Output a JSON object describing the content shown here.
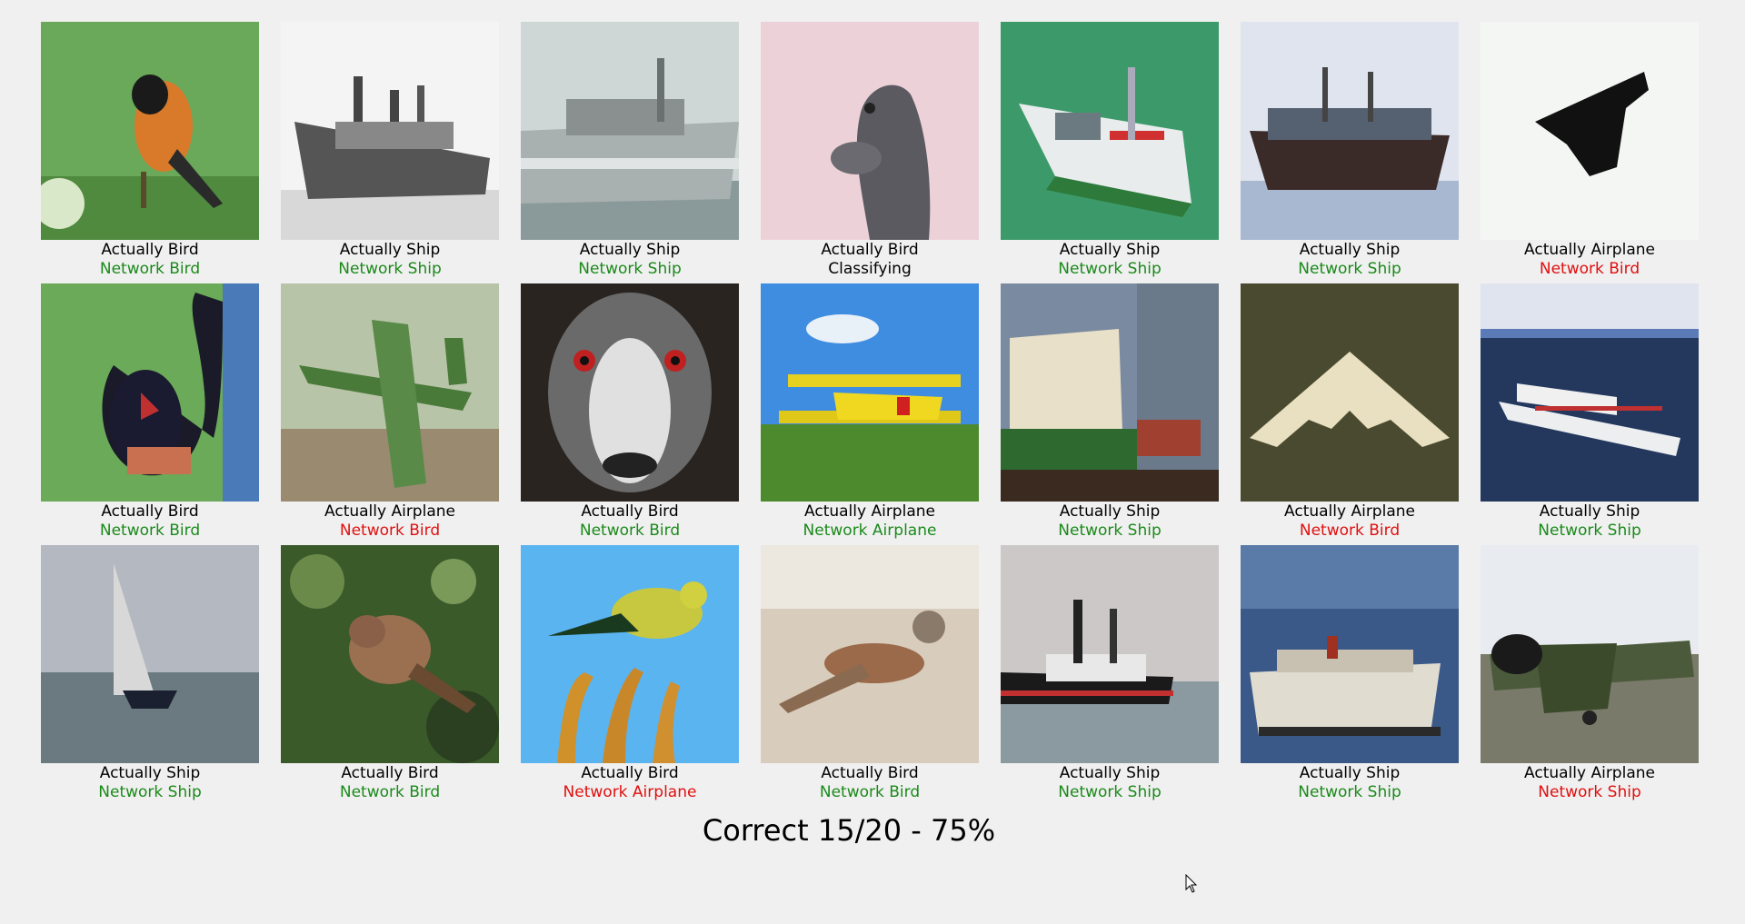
{
  "items": [
    {
      "actual": "Actually Bird",
      "network": "Network Bird",
      "status": "correct",
      "scene": "bird-on-branch-green"
    },
    {
      "actual": "Actually Ship",
      "network": "Network Ship",
      "status": "correct",
      "scene": "ship-grayscale"
    },
    {
      "actual": "Actually Ship",
      "network": "Network Ship",
      "status": "correct",
      "scene": "ship-gray-fog"
    },
    {
      "actual": "Actually Bird",
      "network": "Classifying",
      "status": "pending",
      "scene": "ostrich-head-pink"
    },
    {
      "actual": "Actually Ship",
      "network": "Network Ship",
      "status": "correct",
      "scene": "boat-green-water"
    },
    {
      "actual": "Actually Ship",
      "network": "Network Ship",
      "status": "correct",
      "scene": "ship-harbor"
    },
    {
      "actual": "Actually Airplane",
      "network": "Network Bird",
      "status": "wrong",
      "scene": "black-jet-white"
    },
    {
      "actual": "Actually Bird",
      "network": "Network Bird",
      "status": "correct",
      "scene": "rooster-grass"
    },
    {
      "actual": "Actually Airplane",
      "network": "Network Bird",
      "status": "wrong",
      "scene": "green-warplane"
    },
    {
      "actual": "Actually Bird",
      "network": "Network Bird",
      "status": "correct",
      "scene": "emu-face"
    },
    {
      "actual": "Actually Airplane",
      "network": "Network Airplane",
      "status": "correct",
      "scene": "yellow-biplane"
    },
    {
      "actual": "Actually Ship",
      "network": "Network Ship",
      "status": "correct",
      "scene": "ship-dock"
    },
    {
      "actual": "Actually Airplane",
      "network": "Network Bird",
      "status": "wrong",
      "scene": "flying-wing"
    },
    {
      "actual": "Actually Ship",
      "network": "Network Ship",
      "status": "correct",
      "scene": "cruise-ship-sea"
    },
    {
      "actual": "Actually Ship",
      "network": "Network Ship",
      "status": "correct",
      "scene": "sailboat-gray"
    },
    {
      "actual": "Actually Bird",
      "network": "Network Bird",
      "status": "correct",
      "scene": "sparrow-foliage"
    },
    {
      "actual": "Actually Bird",
      "network": "Network Airplane",
      "status": "wrong",
      "scene": "yellow-bird-sky"
    },
    {
      "actual": "Actually Bird",
      "network": "Network Bird",
      "status": "correct",
      "scene": "bird-sand"
    },
    {
      "actual": "Actually Ship",
      "network": "Network Ship",
      "status": "correct",
      "scene": "tugboat-gray"
    },
    {
      "actual": "Actually Ship",
      "network": "Network Ship",
      "status": "correct",
      "scene": "cruise-ship-blue"
    },
    {
      "actual": "Actually Airplane",
      "network": "Network Ship",
      "status": "wrong",
      "scene": "camo-plane-ground"
    }
  ],
  "score": "Correct 15/20 - 75%",
  "colors": {
    "correct": "#1a8a1a",
    "wrong": "#e01010",
    "pending": "#000000"
  }
}
